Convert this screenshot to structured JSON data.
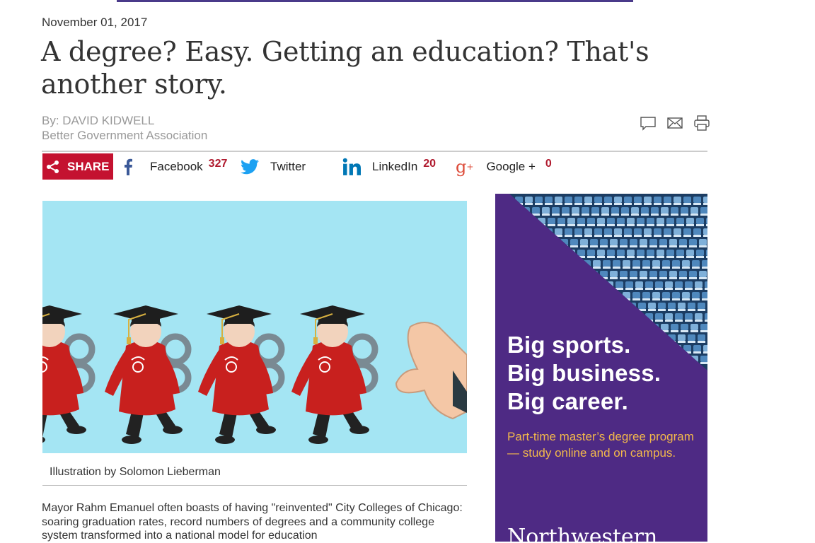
{
  "article": {
    "date": "November 01, 2017",
    "headline": "A degree? Easy. Getting an education? That's another story.",
    "author": "By: DAVID KIDWELL",
    "organization": "Better Government Association",
    "caption": "Illustration by Solomon Lieberman",
    "body": "Mayor Rahm Emanuel often boasts of having \"reinvented\" City Colleges of Chicago: soaring graduation rates, record numbers of degrees and a community college system transformed into a national model for education"
  },
  "tools": {
    "icons": [
      "comment-icon",
      "email-icon",
      "print-icon"
    ]
  },
  "share": {
    "label": "SHARE",
    "items": [
      {
        "name": "Facebook",
        "count": "327",
        "icon": "facebook-icon",
        "color": "#3b5998"
      },
      {
        "name": "Twitter",
        "count": "",
        "icon": "twitter-icon",
        "color": "#1da1f2"
      },
      {
        "name": "LinkedIn",
        "count": "20",
        "icon": "linkedin-icon",
        "color": "#0077b5"
      },
      {
        "name": "Google +",
        "count": "0",
        "icon": "google-plus-icon",
        "color": "#dd4b39"
      }
    ]
  },
  "ad": {
    "headline": [
      "Big sports.",
      "Big business.",
      "Big career."
    ],
    "subtext": "Part-time master’s degree program — study online and on campus.",
    "brand": "Northwestern",
    "colors": {
      "background": "#4e2a84",
      "accent": "#f2b84b"
    }
  },
  "colors": {
    "share_red": "#c41230",
    "count_red": "#b01a2e",
    "hero_bg": "#a4e5f3"
  }
}
